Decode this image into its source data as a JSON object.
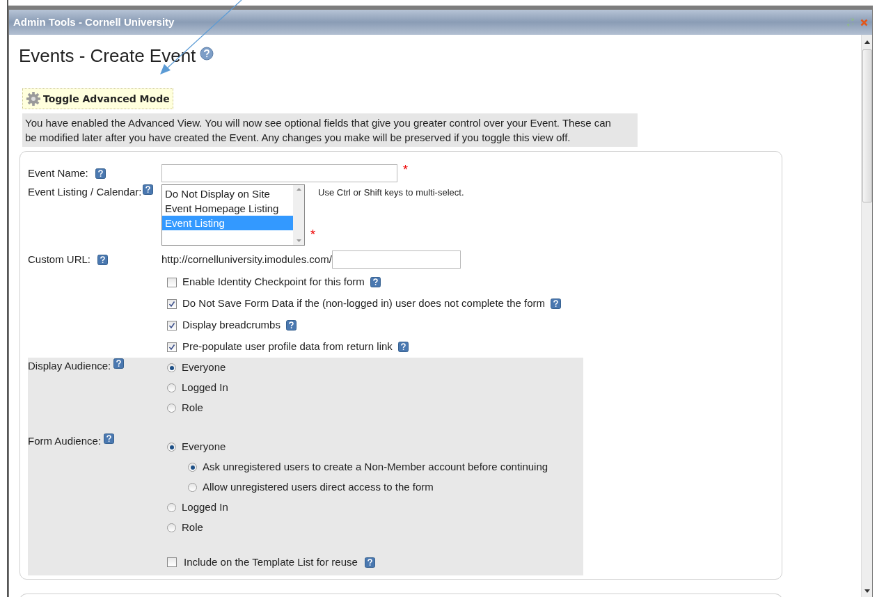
{
  "window": {
    "title": "Admin Tools - Cornell University"
  },
  "page": {
    "title": "Events - Create Event",
    "toggle_button": "Toggle Advanced Mode",
    "notice": "You have enabled the Advanced View. You will now see optional fields that give you greater control over your Event. These can be modified later after you have created the Event. Any changes you make will be preserved if you toggle this view off."
  },
  "form": {
    "event_name": {
      "label": "Event Name:",
      "required_mark": "*"
    },
    "event_listing": {
      "label": "Event Listing / Calendar:",
      "options": [
        {
          "label": "Do Not Display on Site",
          "selected": false
        },
        {
          "label": "Event Homepage Listing",
          "selected": false
        },
        {
          "label": "Event Listing",
          "selected": true
        }
      ],
      "hint": "Use Ctrl or Shift keys to multi-select.",
      "required_mark": "*"
    },
    "custom_url": {
      "label": "Custom URL:",
      "prefix": "http://cornelluniversity.imodules.com/"
    },
    "options": [
      {
        "label": "Enable Identity Checkpoint for this form",
        "checked": false
      },
      {
        "label": "Do Not Save Form Data if the (non-logged in) user does not complete the form",
        "checked": true
      },
      {
        "label": "Display breadcrumbs",
        "checked": true
      },
      {
        "label": "Pre-populate user profile data from return link",
        "checked": true
      }
    ],
    "display_audience": {
      "label": "Display Audience:",
      "options": [
        {
          "label": "Everyone",
          "selected": true
        },
        {
          "label": "Logged In",
          "selected": false
        },
        {
          "label": "Role",
          "selected": false
        }
      ]
    },
    "form_audience": {
      "label": "Form Audience:",
      "options": [
        {
          "label": "Everyone",
          "selected": true,
          "children": [
            {
              "label": "Ask unregistered users to create a Non-Member account before continuing",
              "selected": true
            },
            {
              "label": "Allow unregistered users direct access to the form",
              "selected": false
            }
          ]
        },
        {
          "label": "Logged In",
          "selected": false
        },
        {
          "label": "Role",
          "selected": false
        }
      ]
    },
    "template": {
      "label": "Include on the Template List for reuse",
      "checked": false
    }
  }
}
